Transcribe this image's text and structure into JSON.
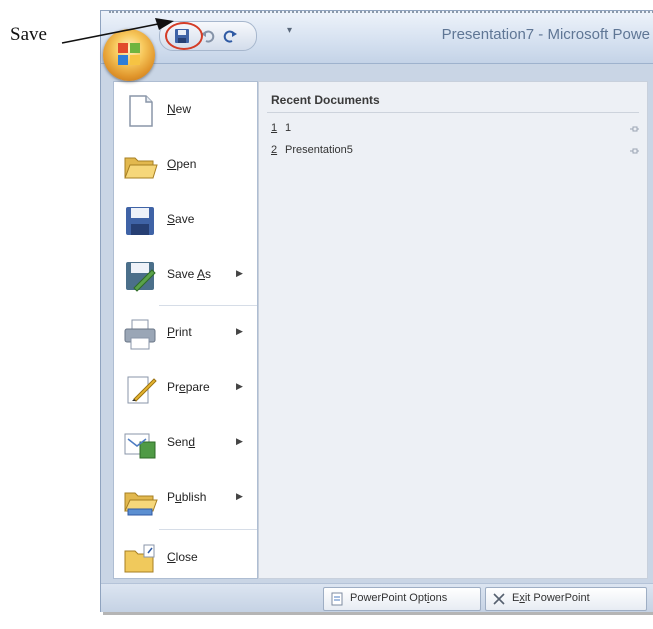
{
  "callout": {
    "label": "Save"
  },
  "window": {
    "title": "Presentation7 - Microsoft Powe",
    "quick_access": [
      {
        "name": "save",
        "icon": "save-icon"
      },
      {
        "name": "undo",
        "icon": "undo-icon"
      },
      {
        "name": "redo",
        "icon": "redo-icon"
      },
      {
        "name": "customize",
        "icon": "dropdown-icon"
      }
    ],
    "office_button_icon": "office-logo-icon"
  },
  "menu": {
    "items": [
      {
        "label_pre": "",
        "label_key": "N",
        "label_post": "ew",
        "icon": "new-document-icon",
        "submenu": false
      },
      {
        "label_pre": "",
        "label_key": "O",
        "label_post": "pen",
        "icon": "open-folder-icon",
        "submenu": false
      },
      {
        "label_pre": "",
        "label_key": "S",
        "label_post": "ave",
        "icon": "save-disk-icon",
        "submenu": false
      },
      {
        "label_pre": "Save ",
        "label_key": "A",
        "label_post": "s",
        "icon": "save-as-icon",
        "submenu": true
      },
      {
        "label_pre": "",
        "label_key": "P",
        "label_post": "rint",
        "icon": "printer-icon",
        "submenu": true
      },
      {
        "label_pre": "Pr",
        "label_key": "e",
        "label_post": "pare",
        "icon": "prepare-icon",
        "submenu": true
      },
      {
        "label_pre": "Sen",
        "label_key": "d",
        "label_post": "",
        "icon": "send-icon",
        "submenu": true
      },
      {
        "label_pre": "P",
        "label_key": "u",
        "label_post": "blish",
        "icon": "publish-icon",
        "submenu": true
      },
      {
        "label_pre": "",
        "label_key": "C",
        "label_post": "lose",
        "icon": "close-folder-icon",
        "submenu": false
      }
    ]
  },
  "recent": {
    "title": "Recent Documents",
    "items": [
      {
        "number": "1",
        "name": "1"
      },
      {
        "number": "2",
        "name": "Presentation5"
      }
    ]
  },
  "footer": {
    "options_pre": "PowerPoint Opt",
    "options_key": "i",
    "options_post": "ons",
    "exit_pre": "E",
    "exit_key": "x",
    "exit_post": "it PowerPoint"
  },
  "colors": {
    "accent_red": "#d43c26",
    "office_orange": "#e0952b",
    "frame_blue": "#c9d5e5"
  }
}
